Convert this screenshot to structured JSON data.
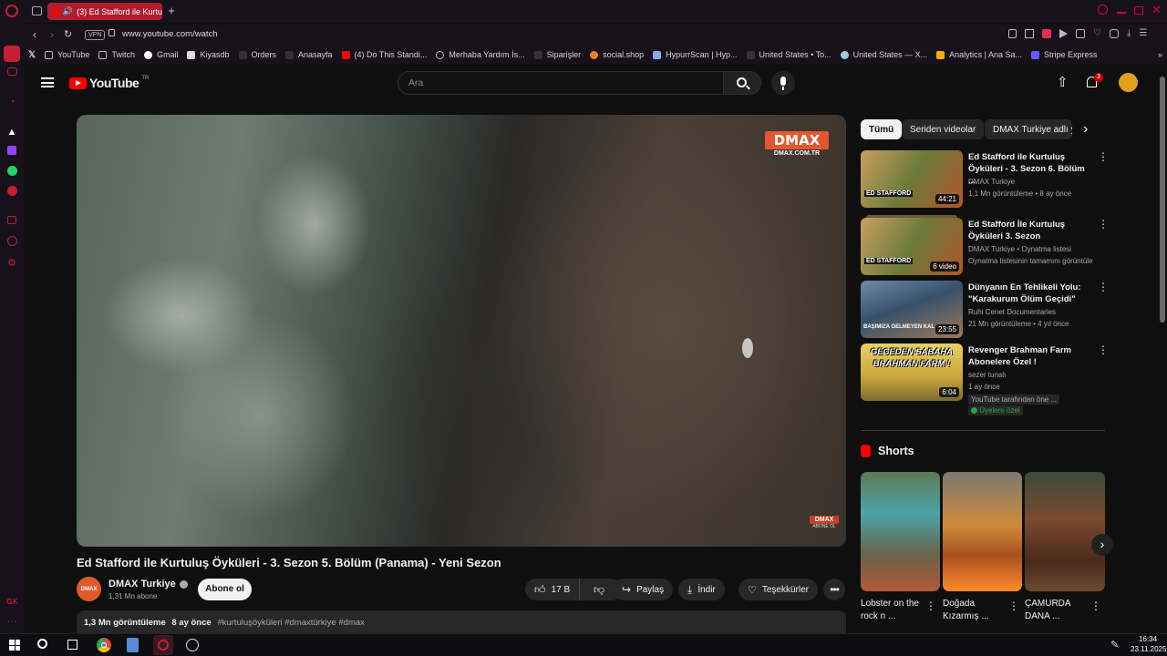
{
  "browser": {
    "tab_title": "(3) Ed Stafford ile Kurtu",
    "vpn_label": "VPN",
    "url": "www.youtube.com/watch",
    "bookmarks": [
      "YouTube",
      "Twitch",
      "Gmail",
      "Kiyasdb",
      "Orders",
      "Anasayfa",
      "(4) Do This Standi...",
      "Merhaba Yardım İs...",
      "Siparişler",
      "social.shop",
      "HypurrScan | Hyp...",
      "United States • To...",
      "United States — X...",
      "Analytics | Ana Sa...",
      "Stripe Express"
    ],
    "sidebar_label": "GX"
  },
  "youtube": {
    "logo_text": "YouTube",
    "logo_region": "TR",
    "search_placeholder": "Ara",
    "notification_count": "3",
    "video": {
      "watermark_top": "DMAX",
      "watermark_sub": "DMAX.COM.TR",
      "watermark_corner": "DMAX",
      "watermark_corner_sub": "ABONE OL",
      "title": "Ed Stafford ile Kurtuluş Öyküleri - 3. Sezon 5. Bölüm (Panama) - Yeni Sezon",
      "channel": "DMAX Turkiye",
      "channel_avatar_text": "DMAX",
      "subscribers": "1,31 Mn abone",
      "subscribe_label": "Abone ol",
      "like_count": "17 B",
      "share_label": "Paylaş",
      "download_label": "İndir",
      "thanks_label": "Teşekkürler",
      "views": "1,3 Mn görüntüleme",
      "age": "8 ay önce",
      "hashtags": "#kurtuluşöyküleri #dmaxtürkiye #dmax"
    },
    "chips": [
      "Tümü",
      "Seriden videolar",
      "DMAX Turkiye adlı yü"
    ],
    "recommendations": [
      {
        "title": "Ed Stafford ile Kurtuluş Öyküleri - 3. Sezon 6. Bölüm ...",
        "channel": "DMAX Turkiye",
        "meta": "1,1 Mn görüntüleme • 8 ay önce",
        "badge": "44:21"
      },
      {
        "title": "Ed Stafford İle Kurtuluş Öyküleri 3. Sezon",
        "channel": "DMAX Turkiye",
        "channel_suffix": "• Oynatma listesi",
        "meta": "Oynatma listesinin tamamını görüntüle",
        "badge": "6 video"
      },
      {
        "title": "Dünyanın En Tehlikeli Yolu: \"Karakurum Ölüm Geçidi\"",
        "channel": "Ruhi Cenet Documentaries",
        "meta": "21 Mn görüntüleme • 4 yıl önce",
        "badge": "23:55"
      },
      {
        "title": "Revenger Brahman Farm Abonelere Özel !",
        "channel": "sezer tunalı",
        "meta": "1 ay önce",
        "meta2": "YouTube tarafından öne ...",
        "members_label": "Üyelere özel",
        "badge": "6:04"
      }
    ],
    "thumb_texts": [
      "ED STAFFORD",
      "ED STAFFORD",
      "BAŞIMIZA GELMEYEN KAL",
      "GECEDEN SABAHA BRAHMAN FARM !"
    ],
    "shorts_heading": "Shorts",
    "shorts": [
      {
        "title": "Lobster on the rock n ..."
      },
      {
        "title": "Doğada Kızarmış ..."
      },
      {
        "title": "ÇAMURDA DANA ..."
      }
    ]
  },
  "taskbar": {
    "time": "16:34",
    "date": "23.11.2025"
  },
  "colors": {
    "youtube_red": "#ff0000",
    "opera_red": "#c81d32",
    "yt_bg": "#0f0f0f",
    "chip_bg": "#272727",
    "members_green": "#2ba640"
  }
}
